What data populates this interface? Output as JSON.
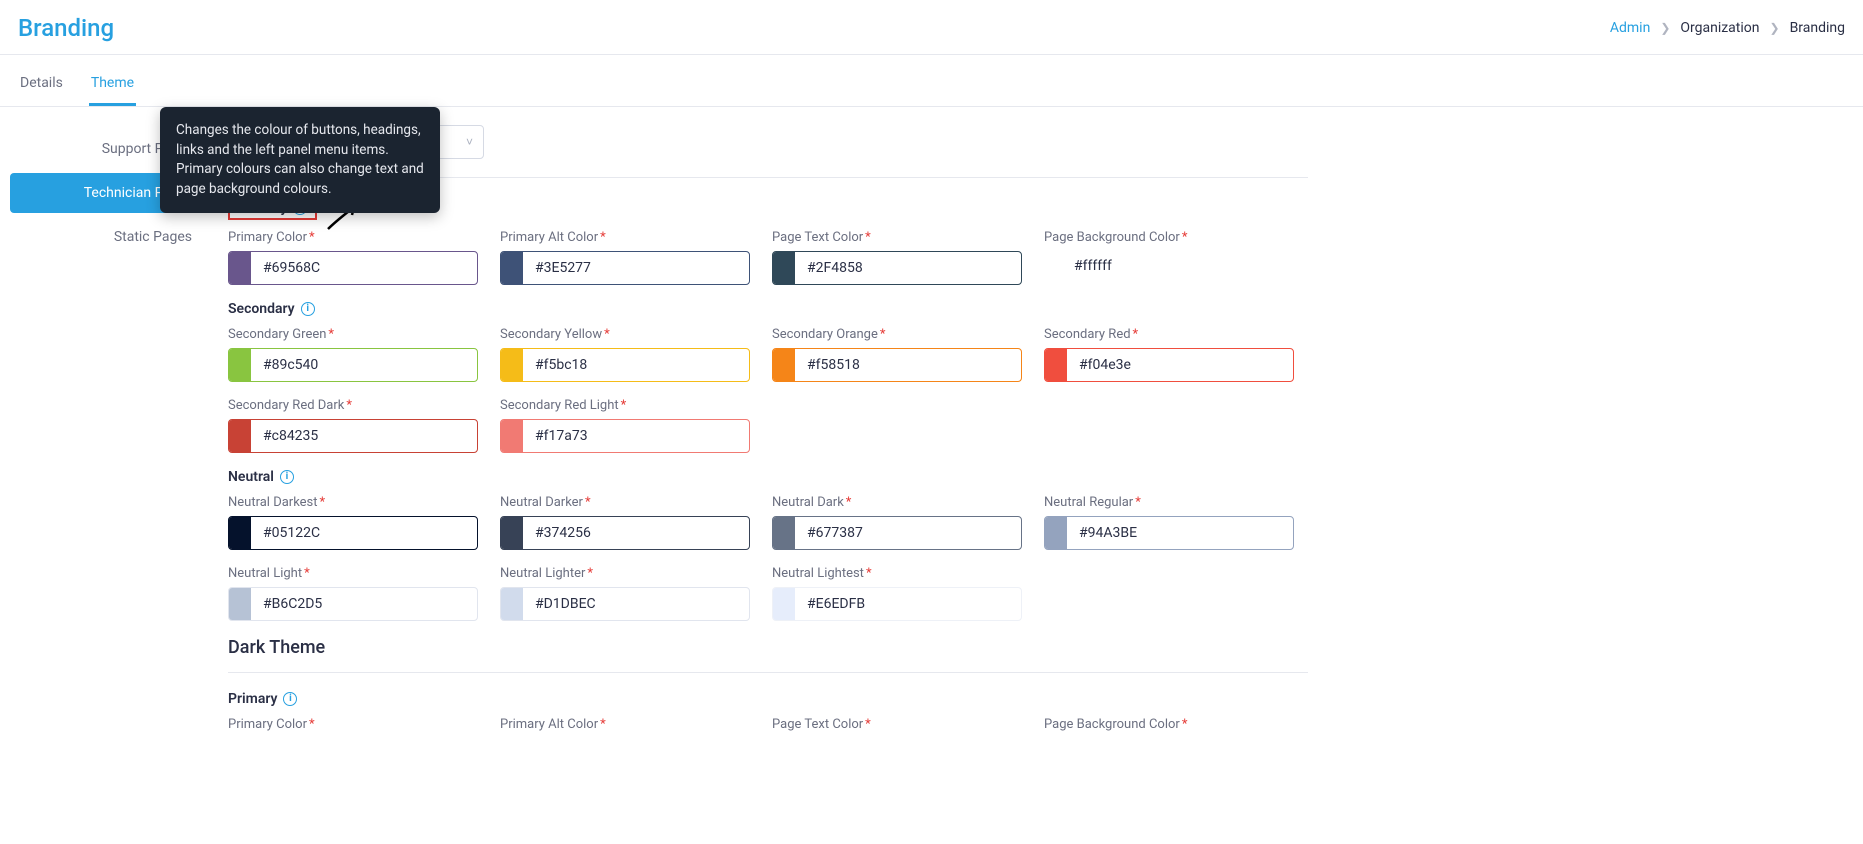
{
  "page": {
    "title": "Branding"
  },
  "breadcrumb": {
    "admin": "Admin",
    "org": "Organization",
    "branding": "Branding"
  },
  "tabs": {
    "details": "Details",
    "theme": "Theme"
  },
  "sidenav": {
    "support": "Support Portal",
    "tech": "Technician Portal",
    "static": "Static Pages"
  },
  "tooltip": "Changes the colour of buttons, headings, links and the left panel menu items. Primary colours can also change text and page background colours.",
  "groups": {
    "primary": {
      "heading": "Primary",
      "fields": {
        "primary_color": {
          "label": "Primary Color",
          "value": "#69568C",
          "swatch": "#69568C"
        },
        "primary_alt": {
          "label": "Primary Alt Color",
          "value": "#3E5277",
          "swatch": "#3E5277"
        },
        "page_text": {
          "label": "Page Text Color",
          "value": "#2F4858",
          "swatch": "#2F4858"
        },
        "page_bg": {
          "label": "Page Background Color",
          "value": "#ffffff"
        }
      }
    },
    "secondary": {
      "heading": "Secondary",
      "fields": {
        "green": {
          "label": "Secondary Green",
          "value": "#89c540",
          "swatch": "#89c540"
        },
        "yellow": {
          "label": "Secondary Yellow",
          "value": "#f5bc18",
          "swatch": "#f5bc18"
        },
        "orange": {
          "label": "Secondary Orange",
          "value": "#f58518",
          "swatch": "#f58518"
        },
        "red": {
          "label": "Secondary Red",
          "value": "#f04e3e",
          "swatch": "#f04e3e"
        },
        "red_dark": {
          "label": "Secondary Red Dark",
          "value": "#c84235",
          "swatch": "#c84235"
        },
        "red_light": {
          "label": "Secondary Red Light",
          "value": "#f17a73",
          "swatch": "#f17a73"
        }
      }
    },
    "neutral": {
      "heading": "Neutral",
      "fields": {
        "darkest": {
          "label": "Neutral Darkest",
          "value": "#05122C",
          "swatch": "#05122C"
        },
        "darker": {
          "label": "Neutral Darker",
          "value": "#374256",
          "swatch": "#374256"
        },
        "dark": {
          "label": "Neutral Dark",
          "value": "#677387",
          "swatch": "#677387"
        },
        "regular": {
          "label": "Neutral Regular",
          "value": "#94A3BE",
          "swatch": "#94A3BE"
        },
        "light": {
          "label": "Neutral Light",
          "value": "#B6C2D5",
          "swatch": "#B6C2D5"
        },
        "lighter": {
          "label": "Neutral Lighter",
          "value": "#D1DBEC",
          "swatch": "#D1DBEC"
        },
        "lightest": {
          "label": "Neutral Lightest",
          "value": "#E6EDFB",
          "swatch": "#E6EDFB"
        }
      }
    }
  },
  "dark_theme": {
    "heading": "Dark Theme",
    "primary_heading": "Primary",
    "labels": {
      "primary_color": "Primary Color",
      "primary_alt": "Primary Alt Color",
      "page_text": "Page Text Color",
      "page_bg": "Page Background Color"
    }
  }
}
